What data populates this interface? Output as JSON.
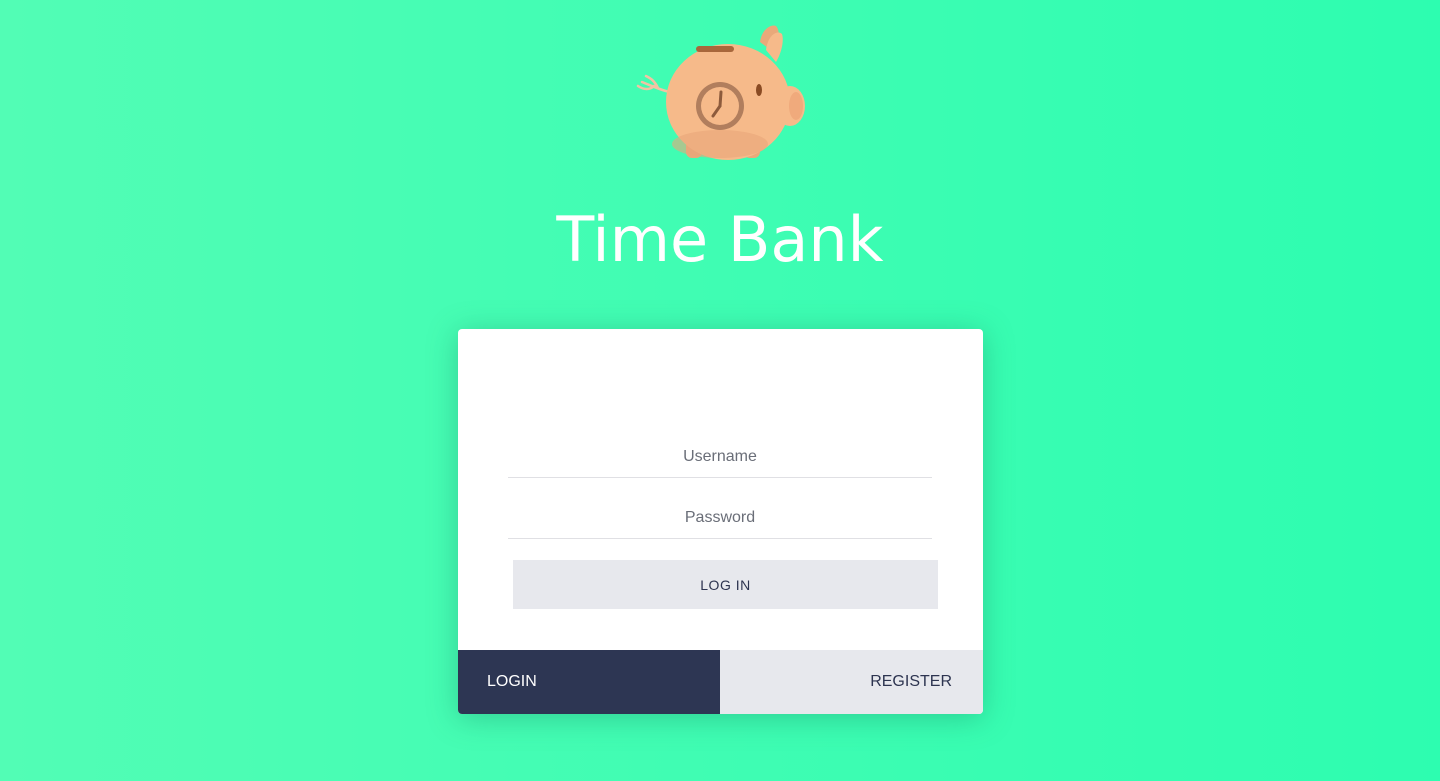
{
  "app": {
    "title": "Time Bank",
    "logo_icon": "piggy-bank-clock-icon"
  },
  "form": {
    "username_placeholder": "Username",
    "password_placeholder": "Password",
    "submit_label": "LOG IN"
  },
  "tabs": [
    {
      "label": "LOGIN",
      "active": true
    },
    {
      "label": "REGISTER",
      "active": false
    }
  ],
  "colors": {
    "background_start": "#52fdb5",
    "background_end": "#2dfdb0",
    "active_tab": "#2d3653",
    "inactive_tab": "#e7e8ed",
    "button": "#e7e8ed",
    "piggy": "#f6ba8a"
  }
}
